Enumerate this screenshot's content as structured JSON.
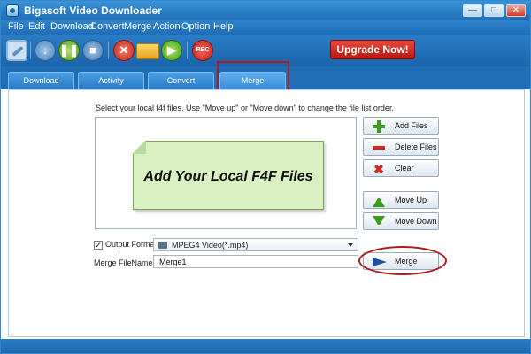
{
  "window": {
    "title": "Bigasoft Video Downloader"
  },
  "menu": [
    "File",
    "Edit",
    "Download",
    "Convert",
    "Merge",
    "Action",
    "Option",
    "Help"
  ],
  "toolbar": {
    "icons": [
      "link-icon",
      "download-icon",
      "pause-icon",
      "stop-icon",
      "delete-icon",
      "folder-icon",
      "play-icon",
      "record-icon"
    ],
    "rec_label": "REC",
    "upgrade_label": "Upgrade Now!"
  },
  "tabs": [
    {
      "label": "Download"
    },
    {
      "label": "Activity"
    },
    {
      "label": "Convert"
    },
    {
      "label": "Merge"
    }
  ],
  "active_tab": "Merge",
  "main": {
    "instructions": "Select your local f4f files. Use \"Move up\" or \"Move down\" to change the file list order.",
    "placeholder_note": "Add Your Local F4F Files",
    "buttons": {
      "add_files": "Add Files",
      "delete_files": "Delete Files",
      "clear": "Clear",
      "move_up": "Move Up",
      "move_down": "Move Down",
      "merge": "Merge"
    },
    "output_format_label": "Output Format:",
    "output_format_value": "MPEG4 Video(*.mp4)",
    "output_format_checked": true,
    "merge_filename_label": "Merge FileName:",
    "merge_filename_value": "Merge1"
  },
  "colors": {
    "accent": "#1f6db5",
    "upgrade": "#c8231a",
    "highlight": "#b01a1a",
    "note": "#d9f0c2"
  }
}
